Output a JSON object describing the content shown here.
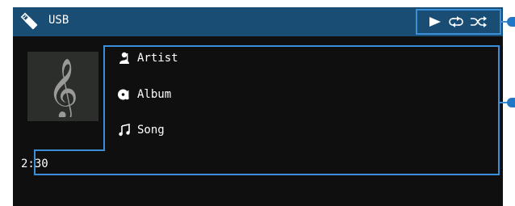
{
  "header": {
    "source": "USB",
    "source_icon": "usb-drive-icon",
    "status_icons": [
      "play-icon",
      "repeat-icon",
      "shuffle-icon"
    ]
  },
  "album_art": {
    "icon": "treble-clef-icon"
  },
  "track": {
    "artist_icon": "artist-icon",
    "artist": "Artist",
    "album_icon": "album-icon",
    "album": "Album",
    "song_icon": "song-note-icon",
    "song": "Song"
  },
  "playback": {
    "elapsed": "2:30"
  },
  "colors": {
    "header_bg": "#1a4d74",
    "screen_bg": "#0f0f10",
    "highlight": "#3b8fd9",
    "callout": "#1f77c5"
  }
}
